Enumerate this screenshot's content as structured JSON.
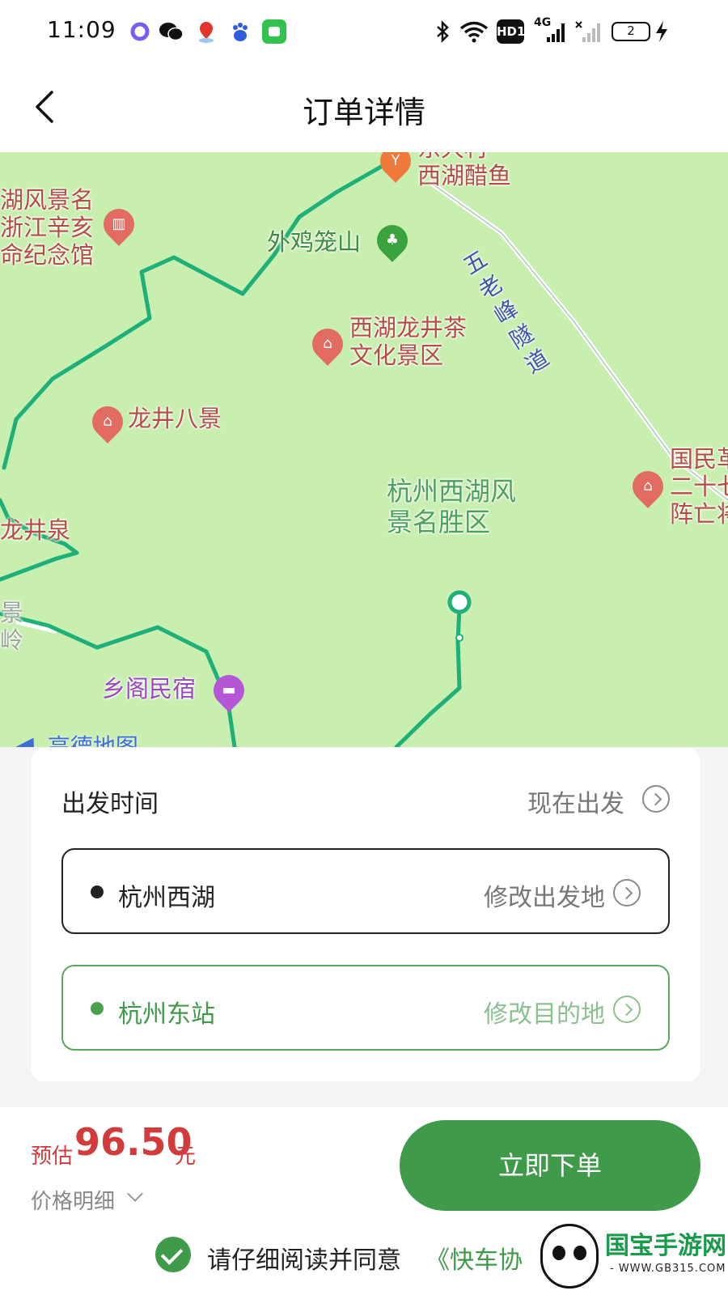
{
  "status_bar": {
    "time": "11:09",
    "icons": [
      "assistant-icon",
      "wechat-icon",
      "location-app-icon",
      "baidu-icon",
      "android-app-icon",
      "bluetooth-icon",
      "wifi-icon",
      "hd-icon",
      "signal-4g-icon",
      "signal-off-icon",
      "battery-icon",
      "charging-icon"
    ],
    "hd_text": "HD1",
    "network_text": "4G",
    "battery_level": "2"
  },
  "header": {
    "title": "订单详情",
    "back_icon": "chevron-left-icon"
  },
  "map": {
    "pois": {
      "restaurant": "东大村\n西湖醋鱼",
      "memorial": "湖风景名\n浙江辛亥\n命纪念馆",
      "mountain": "外鸡笼山",
      "tunnel": "五\n老\n峰\n隧\n道",
      "tea_area": "西湖龙井茶\n文化景区",
      "longjing_eight": "龙井八景",
      "scenic_area": "杭州西湖风\n景名胜区",
      "martyrs": "国民革\n二十七\n阵亡将",
      "spring": "龙井泉",
      "ling": "景\n岭",
      "homestay": "乡阁民宿",
      "logo": "高德地图"
    },
    "colors": {
      "land": "#c8eeb0",
      "route": "#1fb07a",
      "road": "#ffffff"
    }
  },
  "trip": {
    "depart_label": "出发时间",
    "depart_value": "现在出发",
    "origin_name": "杭州西湖",
    "origin_action": "修改出发地",
    "destination_name": "杭州东站",
    "destination_action": "修改目的地"
  },
  "price": {
    "prefix": "预估",
    "value": "96.50",
    "unit": "元",
    "detail_label": "价格明细"
  },
  "order_button": "立即下单",
  "agreement": {
    "text": "请仔细阅读并同意",
    "link": "《快车协"
  },
  "watermark": {
    "title": "国宝手游网",
    "url": "- WWW.GB315.COM -"
  },
  "theme": {
    "primary_green": "#3f9a49",
    "price_red": "#d23b3b"
  }
}
